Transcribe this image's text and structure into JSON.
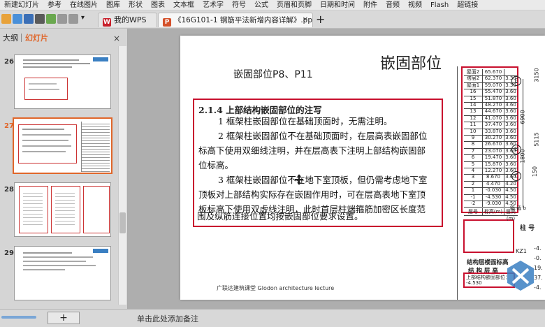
{
  "menu": {
    "items": [
      "新建幻灯片",
      "参考",
      "在线图片",
      "图库",
      "形状",
      "图表",
      "文本框",
      "艺术字",
      "符号",
      "公式",
      "页眉和页脚",
      "日期和时间",
      "附件",
      "音频",
      "视频",
      "Flash",
      "超链接"
    ]
  },
  "tabs": [
    {
      "label": "我的WPS",
      "logo": "W",
      "logo_color": "#c8202b"
    },
    {
      "label": "《16G101-1 钢筋平法新增内容详解》.ppt",
      "logo": "P",
      "logo_color": "#d4502a"
    }
  ],
  "tab_add": "+",
  "panel": {
    "tab_outline": "大纲",
    "tab_slides": "幻灯片"
  },
  "thumbnails": [
    {
      "number": "26",
      "selected": false
    },
    {
      "number": "27",
      "selected": true
    },
    {
      "number": "28",
      "selected": false
    },
    {
      "number": "29",
      "selected": false
    }
  ],
  "slide": {
    "heading": "嵌固部位",
    "subheading": "嵌固部位P8、P11",
    "note_title": "2.1.4  上部结构嵌固部位的注写",
    "note_lines": [
      "1 框架柱嵌固部位在基础顶面时，无需注明。",
      "2 框架柱嵌固部位不在基础顶面时，在层高表嵌固部位",
      "标高下使用双细线注明，并在层高表下注明上部结构嵌固部",
      "位标高。",
      "3 框架柱嵌固部位不在地下室顶板，但仍需考虑地下室",
      "顶板对上部结构实际存在嵌固作用时，可在层高表地下室顶",
      "板标高下使用双虚线注明，此时首层柱端箍筋加密区长度范",
      "围及纵筋连接位置均按嵌固部位要求设置。"
    ],
    "footer": "广联达建筑课堂   Glodon  architecture  lecture",
    "table_rows": [
      {
        "floor": "屋面2",
        "elev": "65.670",
        "h": ""
      },
      {
        "floor": "塔层2",
        "elev": "62.370",
        "h": "3.30"
      },
      {
        "floor": "屋面1",
        "elev": "59.070",
        "h": "3.30"
      },
      {
        "floor": "16",
        "elev": "55.470",
        "h": "3.60"
      },
      {
        "floor": "15",
        "elev": "51.870",
        "h": "3.60"
      },
      {
        "floor": "14",
        "elev": "48.270",
        "h": "3.60"
      },
      {
        "floor": "13",
        "elev": "44.670",
        "h": "3.60"
      },
      {
        "floor": "12",
        "elev": "41.070",
        "h": "3.60"
      },
      {
        "floor": "11",
        "elev": "37.470",
        "h": "3.60"
      },
      {
        "floor": "10",
        "elev": "33.870",
        "h": "3.60"
      },
      {
        "floor": "9",
        "elev": "30.270",
        "h": "3.60"
      },
      {
        "floor": "8",
        "elev": "26.670",
        "h": "3.60"
      },
      {
        "floor": "7",
        "elev": "23.070",
        "h": "3.60"
      },
      {
        "floor": "6",
        "elev": "19.470",
        "h": "3.60"
      },
      {
        "floor": "5",
        "elev": "15.870",
        "h": "3.60"
      },
      {
        "floor": "4",
        "elev": "12.270",
        "h": "3.60"
      },
      {
        "floor": "3",
        "elev": "8.670",
        "h": "3.60"
      },
      {
        "floor": "2",
        "elev": "4.470",
        "h": "4.20"
      },
      {
        "floor": "1",
        "elev": "-0.030",
        "h": "4.50"
      },
      {
        "floor": "-1",
        "elev": "-4.530",
        "h": "4.50"
      },
      {
        "floor": "-2",
        "elev": "-9.030",
        "h": "4.50"
      }
    ],
    "table_header": {
      "floor": "层号",
      "elev": "标高(m)",
      "h": "层高(m)"
    },
    "table_caption_1": "结构层楼面标高",
    "table_caption_2": "结 构 层 高",
    "table_caption_3": "上部结构嵌固部位：",
    "table_caption_4": "-4.530",
    "right_dims": [
      "3150",
      "6900",
      "5115",
      "1800",
      "150"
    ],
    "right_labels": [
      "E",
      "D",
      "C"
    ],
    "col_label": "柱 号",
    "col_sub": "KZ1",
    "dim_label": "箍 截 b",
    "right_vals": [
      "-4.",
      "-0.",
      "19.",
      "37.",
      "-4."
    ]
  },
  "status": {
    "add_button": "+",
    "notes_placeholder": "单击此处添加备注"
  },
  "colors": {
    "accent_red": "#c8102e",
    "selected_border": "#e0662a",
    "logo_blue": "#3a7fc2"
  }
}
